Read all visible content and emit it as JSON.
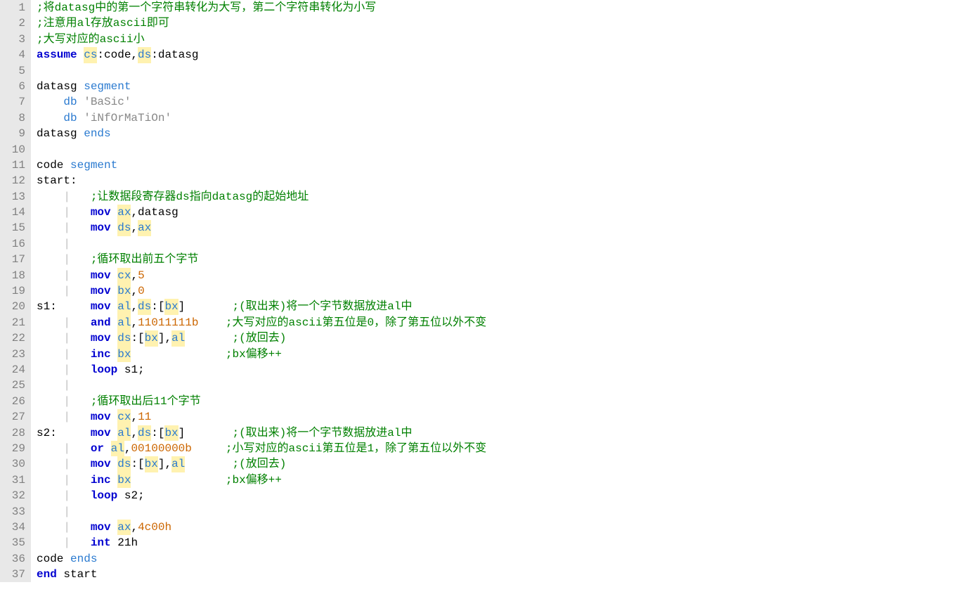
{
  "lines": [
    {
      "n": 1,
      "segs": [
        {
          "t": ";将datasg中的第一个字符串转化为大写，第二个字符串转化为小写",
          "c": "comment"
        }
      ]
    },
    {
      "n": 2,
      "segs": [
        {
          "t": ";注意用al存放ascii即可",
          "c": "comment"
        }
      ]
    },
    {
      "n": 3,
      "segs": [
        {
          "t": ";大写对应的ascii小",
          "c": "comment"
        }
      ]
    },
    {
      "n": 4,
      "segs": [
        {
          "t": "assume",
          "c": "keyword"
        },
        {
          "t": " "
        },
        {
          "t": "cs",
          "c": "kw-light hl"
        },
        {
          "t": ":code,"
        },
        {
          "t": "ds",
          "c": "kw-light hl"
        },
        {
          "t": ":datasg"
        }
      ]
    },
    {
      "n": 5,
      "segs": []
    },
    {
      "n": 6,
      "segs": [
        {
          "t": "datasg "
        },
        {
          "t": "segment",
          "c": "kw-light"
        }
      ]
    },
    {
      "n": 7,
      "segs": [
        {
          "t": "    "
        },
        {
          "t": "db",
          "c": "kw-light"
        },
        {
          "t": " "
        },
        {
          "t": "'BaSic'",
          "c": "str"
        }
      ]
    },
    {
      "n": 8,
      "segs": [
        {
          "t": "    "
        },
        {
          "t": "db",
          "c": "kw-light"
        },
        {
          "t": " "
        },
        {
          "t": "'iNfOrMaTiOn'",
          "c": "str"
        }
      ]
    },
    {
      "n": 9,
      "segs": [
        {
          "t": "datasg "
        },
        {
          "t": "ends",
          "c": "kw-light"
        }
      ]
    },
    {
      "n": 10,
      "segs": []
    },
    {
      "n": 11,
      "segs": [
        {
          "t": "code "
        },
        {
          "t": "segment",
          "c": "kw-light"
        }
      ]
    },
    {
      "n": 12,
      "segs": [
        {
          "t": "start:"
        }
      ]
    },
    {
      "n": 13,
      "segs": [
        {
          "t": "    ",
          "c": "guide"
        },
        {
          "t": "|",
          "c": "guide"
        },
        {
          "t": "   "
        },
        {
          "t": ";让数据段寄存器ds指向datasg的起始地址",
          "c": "comment"
        }
      ]
    },
    {
      "n": 14,
      "segs": [
        {
          "t": "    ",
          "c": "guide"
        },
        {
          "t": "|",
          "c": "guide"
        },
        {
          "t": "   "
        },
        {
          "t": "mov",
          "c": "keyword"
        },
        {
          "t": " "
        },
        {
          "t": "ax",
          "c": "kw-light hl"
        },
        {
          "t": ",datasg"
        }
      ]
    },
    {
      "n": 15,
      "segs": [
        {
          "t": "    ",
          "c": "guide"
        },
        {
          "t": "|",
          "c": "guide"
        },
        {
          "t": "   "
        },
        {
          "t": "mov",
          "c": "keyword"
        },
        {
          "t": " "
        },
        {
          "t": "ds",
          "c": "kw-light hl"
        },
        {
          "t": ","
        },
        {
          "t": "ax",
          "c": "kw-light hl"
        }
      ]
    },
    {
      "n": 16,
      "segs": [
        {
          "t": "    ",
          "c": "guide"
        },
        {
          "t": "|",
          "c": "guide"
        }
      ]
    },
    {
      "n": 17,
      "segs": [
        {
          "t": "    ",
          "c": "guide"
        },
        {
          "t": "|",
          "c": "guide"
        },
        {
          "t": "   "
        },
        {
          "t": ";循环取出前五个字节",
          "c": "comment"
        }
      ]
    },
    {
      "n": 18,
      "segs": [
        {
          "t": "    ",
          "c": "guide"
        },
        {
          "t": "|",
          "c": "guide"
        },
        {
          "t": "   "
        },
        {
          "t": "mov",
          "c": "keyword"
        },
        {
          "t": " "
        },
        {
          "t": "cx",
          "c": "kw-light hl"
        },
        {
          "t": ","
        },
        {
          "t": "5",
          "c": "num"
        }
      ]
    },
    {
      "n": 19,
      "segs": [
        {
          "t": "    ",
          "c": "guide"
        },
        {
          "t": "|",
          "c": "guide"
        },
        {
          "t": "   "
        },
        {
          "t": "mov",
          "c": "keyword"
        },
        {
          "t": " "
        },
        {
          "t": "bx",
          "c": "kw-light hl"
        },
        {
          "t": ","
        },
        {
          "t": "0",
          "c": "num"
        }
      ]
    },
    {
      "n": 20,
      "segs": [
        {
          "t": "s1:     "
        },
        {
          "t": "mov",
          "c": "keyword"
        },
        {
          "t": " "
        },
        {
          "t": "al",
          "c": "kw-light hl"
        },
        {
          "t": ","
        },
        {
          "t": "ds",
          "c": "kw-light hl"
        },
        {
          "t": ":["
        },
        {
          "t": "bx",
          "c": "kw-light hl"
        },
        {
          "t": "]       "
        },
        {
          "t": ";(取出来)将一个字节数据放进al中",
          "c": "comment"
        }
      ]
    },
    {
      "n": 21,
      "segs": [
        {
          "t": "    ",
          "c": "guide"
        },
        {
          "t": "|",
          "c": "guide"
        },
        {
          "t": "   "
        },
        {
          "t": "and",
          "c": "keyword"
        },
        {
          "t": " "
        },
        {
          "t": "al",
          "c": "kw-light hl"
        },
        {
          "t": ","
        },
        {
          "t": "11011111b",
          "c": "num"
        },
        {
          "t": "    "
        },
        {
          "t": ";大写对应的ascii第五位是0，除了第五位以外不变",
          "c": "comment"
        }
      ]
    },
    {
      "n": 22,
      "segs": [
        {
          "t": "    ",
          "c": "guide"
        },
        {
          "t": "|",
          "c": "guide"
        },
        {
          "t": "   "
        },
        {
          "t": "mov",
          "c": "keyword"
        },
        {
          "t": " "
        },
        {
          "t": "ds",
          "c": "kw-light hl"
        },
        {
          "t": ":["
        },
        {
          "t": "bx",
          "c": "kw-light hl"
        },
        {
          "t": "],"
        },
        {
          "t": "al",
          "c": "kw-light hl"
        },
        {
          "t": "       "
        },
        {
          "t": ";(放回去)",
          "c": "comment"
        }
      ]
    },
    {
      "n": 23,
      "segs": [
        {
          "t": "    ",
          "c": "guide"
        },
        {
          "t": "|",
          "c": "guide"
        },
        {
          "t": "   "
        },
        {
          "t": "inc",
          "c": "keyword"
        },
        {
          "t": " "
        },
        {
          "t": "bx",
          "c": "kw-light hl"
        },
        {
          "t": "              "
        },
        {
          "t": ";bx偏移++",
          "c": "comment"
        }
      ]
    },
    {
      "n": 24,
      "segs": [
        {
          "t": "    ",
          "c": "guide"
        },
        {
          "t": "|",
          "c": "guide"
        },
        {
          "t": "   "
        },
        {
          "t": "loop",
          "c": "keyword"
        },
        {
          "t": " s1;"
        }
      ]
    },
    {
      "n": 25,
      "segs": [
        {
          "t": "    ",
          "c": "guide"
        },
        {
          "t": "|",
          "c": "guide"
        }
      ]
    },
    {
      "n": 26,
      "segs": [
        {
          "t": "    ",
          "c": "guide"
        },
        {
          "t": "|",
          "c": "guide"
        },
        {
          "t": "   "
        },
        {
          "t": ";循环取出后11个字节",
          "c": "comment"
        }
      ]
    },
    {
      "n": 27,
      "segs": [
        {
          "t": "    ",
          "c": "guide"
        },
        {
          "t": "|",
          "c": "guide"
        },
        {
          "t": "   "
        },
        {
          "t": "mov",
          "c": "keyword"
        },
        {
          "t": " "
        },
        {
          "t": "cx",
          "c": "kw-light hl"
        },
        {
          "t": ","
        },
        {
          "t": "11",
          "c": "num"
        }
      ]
    },
    {
      "n": 28,
      "segs": [
        {
          "t": "s2:     "
        },
        {
          "t": "mov",
          "c": "keyword"
        },
        {
          "t": " "
        },
        {
          "t": "al",
          "c": "kw-light hl"
        },
        {
          "t": ","
        },
        {
          "t": "ds",
          "c": "kw-light hl"
        },
        {
          "t": ":["
        },
        {
          "t": "bx",
          "c": "kw-light hl"
        },
        {
          "t": "]       "
        },
        {
          "t": ";(取出来)将一个字节数据放进al中",
          "c": "comment"
        }
      ]
    },
    {
      "n": 29,
      "segs": [
        {
          "t": "    ",
          "c": "guide"
        },
        {
          "t": "|",
          "c": "guide"
        },
        {
          "t": "   "
        },
        {
          "t": "or",
          "c": "keyword"
        },
        {
          "t": " "
        },
        {
          "t": "al",
          "c": "kw-light hl"
        },
        {
          "t": ","
        },
        {
          "t": "00100000b",
          "c": "num"
        },
        {
          "t": "     "
        },
        {
          "t": ";小写对应的ascii第五位是1，除了第五位以外不变",
          "c": "comment"
        }
      ]
    },
    {
      "n": 30,
      "segs": [
        {
          "t": "    ",
          "c": "guide"
        },
        {
          "t": "|",
          "c": "guide"
        },
        {
          "t": "   "
        },
        {
          "t": "mov",
          "c": "keyword"
        },
        {
          "t": " "
        },
        {
          "t": "ds",
          "c": "kw-light hl"
        },
        {
          "t": ":["
        },
        {
          "t": "bx",
          "c": "kw-light hl"
        },
        {
          "t": "],"
        },
        {
          "t": "al",
          "c": "kw-light hl"
        },
        {
          "t": "       "
        },
        {
          "t": ";(放回去)",
          "c": "comment"
        }
      ]
    },
    {
      "n": 31,
      "segs": [
        {
          "t": "    ",
          "c": "guide"
        },
        {
          "t": "|",
          "c": "guide"
        },
        {
          "t": "   "
        },
        {
          "t": "inc",
          "c": "keyword"
        },
        {
          "t": " "
        },
        {
          "t": "bx",
          "c": "kw-light hl"
        },
        {
          "t": "              "
        },
        {
          "t": ";bx偏移++",
          "c": "comment"
        }
      ]
    },
    {
      "n": 32,
      "segs": [
        {
          "t": "    ",
          "c": "guide"
        },
        {
          "t": "|",
          "c": "guide"
        },
        {
          "t": "   "
        },
        {
          "t": "loop",
          "c": "keyword"
        },
        {
          "t": " s2;"
        }
      ]
    },
    {
      "n": 33,
      "segs": [
        {
          "t": "    ",
          "c": "guide"
        },
        {
          "t": "|",
          "c": "guide"
        }
      ]
    },
    {
      "n": 34,
      "segs": [
        {
          "t": "    ",
          "c": "guide"
        },
        {
          "t": "|",
          "c": "guide"
        },
        {
          "t": "   "
        },
        {
          "t": "mov",
          "c": "keyword"
        },
        {
          "t": " "
        },
        {
          "t": "ax",
          "c": "kw-light hl"
        },
        {
          "t": ","
        },
        {
          "t": "4c00h",
          "c": "num"
        }
      ]
    },
    {
      "n": 35,
      "segs": [
        {
          "t": "    ",
          "c": "guide"
        },
        {
          "t": "|",
          "c": "guide"
        },
        {
          "t": "   "
        },
        {
          "t": "int",
          "c": "keyword"
        },
        {
          "t": " 21h"
        }
      ]
    },
    {
      "n": 36,
      "segs": [
        {
          "t": "code "
        },
        {
          "t": "ends",
          "c": "kw-light"
        }
      ]
    },
    {
      "n": 37,
      "segs": [
        {
          "t": "end",
          "c": "keyword"
        },
        {
          "t": " start"
        }
      ]
    }
  ]
}
